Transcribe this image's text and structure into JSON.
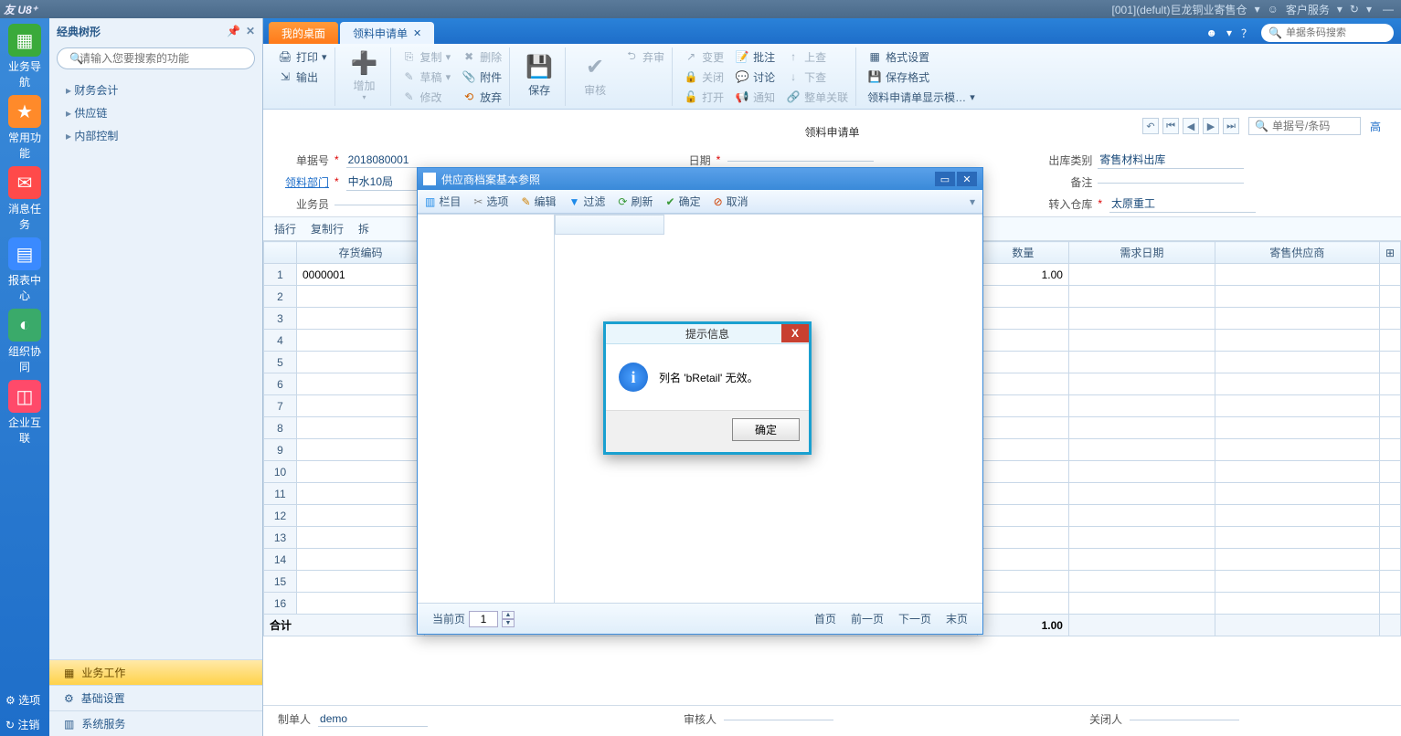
{
  "titlebar": {
    "logo": "友 U8⁺",
    "company": "[001](defult)巨龙铜业寄售仓",
    "service": "客户服务"
  },
  "leftrail": {
    "items": [
      {
        "label": "业务导航",
        "color": "#3aaa3a",
        "icon": "▦"
      },
      {
        "label": "常用功能",
        "color": "#ff8a2a",
        "icon": "★"
      },
      {
        "label": "消息任务",
        "color": "#ff4a4a",
        "icon": "✉"
      },
      {
        "label": "报表中心",
        "color": "#3a8aff",
        "icon": "▤"
      },
      {
        "label": "组织协同",
        "color": "#3aaa6a",
        "icon": "◐"
      },
      {
        "label": "企业互联",
        "color": "#ff4a6a",
        "icon": "◫"
      }
    ],
    "bottom": [
      {
        "label": "选项",
        "icon": "⚙"
      },
      {
        "label": "注销",
        "icon": "↻"
      }
    ]
  },
  "tree": {
    "title": "经典树形",
    "search_placeholder": "请输入您要搜索的功能",
    "nodes": [
      "财务会计",
      "供应链",
      "内部控制"
    ],
    "bottom_tabs": [
      {
        "label": "业务工作",
        "active": true,
        "icon": "▦"
      },
      {
        "label": "基础设置",
        "active": false,
        "icon": "⚙"
      },
      {
        "label": "系统服务",
        "active": false,
        "icon": "▥"
      }
    ]
  },
  "tabs": {
    "items": [
      {
        "label": "我的桌面",
        "active": false
      },
      {
        "label": "领料申请单",
        "active": true
      }
    ],
    "search_placeholder": "单据条码搜索"
  },
  "ribbon": {
    "g1": {
      "print": "打印",
      "output": "输出"
    },
    "g2": {
      "add": "增加",
      "copy": "复制",
      "draft": "草稿",
      "modify": "修改",
      "delete": "删除",
      "attach": "附件",
      "abandon": "放弃"
    },
    "g3": {
      "save": "保存"
    },
    "g4": {
      "audit": "审核",
      "reject": "弃审"
    },
    "g5": {
      "change": "变更",
      "close": "关闭",
      "open": "打开",
      "batch": "批注",
      "discuss": "讨论",
      "notify": "通知",
      "up": "上查",
      "down": "下查",
      "assoc": "整单关联"
    },
    "g6": {
      "format": "格式设置",
      "saveformat": "保存格式",
      "display": "领料申请单显示模…"
    }
  },
  "doc": {
    "title": "领料申请单",
    "nav_search_placeholder": "单据号/条码",
    "more": "高",
    "fields": {
      "docno_label": "单据号",
      "docno": "2018080001",
      "date_label": "日期",
      "outtype_label": "出库类别",
      "outtype": "寄售材料出库",
      "dept_label": "领料部门",
      "dept": "中水10局",
      "remark_label": "备注",
      "remark": "",
      "clerk_label": "业务员",
      "clerk": "",
      "inwh_label": "转入仓库",
      "inwh": "太原重工"
    }
  },
  "gridbar": {
    "insert": "插行",
    "copy": "复制行",
    "split": "拆"
  },
  "grid": {
    "cols": [
      "存货编码",
      "数量",
      "需求日期",
      "寄售供应商"
    ],
    "rows": [
      {
        "n": 1,
        "code": "0000001",
        "qty": "1.00",
        "date": "",
        "vendor": ""
      },
      {
        "n": 2
      },
      {
        "n": 3
      },
      {
        "n": 4
      },
      {
        "n": 5
      },
      {
        "n": 6
      },
      {
        "n": 7
      },
      {
        "n": 8
      },
      {
        "n": 9
      },
      {
        "n": 10
      },
      {
        "n": 11
      },
      {
        "n": 12
      },
      {
        "n": 13
      },
      {
        "n": 14
      },
      {
        "n": 15
      },
      {
        "n": 16
      }
    ],
    "total_label": "合计",
    "total_qty": "1.00"
  },
  "footer": {
    "maker_label": "制单人",
    "maker": "demo",
    "auditor_label": "审核人",
    "auditor": "",
    "closer_label": "关闭人",
    "closer": ""
  },
  "refdlg": {
    "title": "供应商档案基本参照",
    "toolbar": {
      "col": "栏目",
      "opt": "选项",
      "edit": "编辑",
      "filter": "过滤",
      "refresh": "刷新",
      "ok": "确定",
      "cancel": "取消"
    },
    "pager": {
      "cur_label": "当前页",
      "cur": "1",
      "first": "首页",
      "prev": "前一页",
      "next": "下一页",
      "last": "末页"
    }
  },
  "alert": {
    "title": "提示信息",
    "message": "列名 'bRetail' 无效。",
    "ok": "确定"
  }
}
